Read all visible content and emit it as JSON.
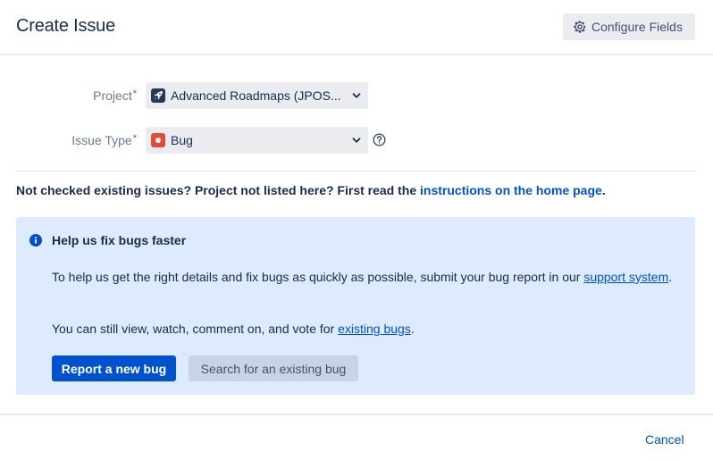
{
  "dialog": {
    "title": "Create Issue",
    "configure_label": "Configure Fields"
  },
  "form": {
    "project": {
      "label": "Project",
      "required_mark": "*",
      "value": "Advanced Roadmaps (JPOS...",
      "icon": "rocket-icon"
    },
    "issue_type": {
      "label": "Issue Type",
      "required_mark": "*",
      "value": "Bug",
      "icon": "bug-icon"
    }
  },
  "notice": {
    "text": "Not checked existing issues? Project not listed here? First read the ",
    "link": "instructions on the home page",
    "suffix": "."
  },
  "panel": {
    "title": "Help us fix bugs faster",
    "p1_text": "To help us get the right details and fix bugs as quickly as possible, submit your bug report in our ",
    "p1_link": "support system",
    "p1_suffix": ".",
    "p2_text": "You can still view, watch, comment on, and vote for ",
    "p2_link": "existing bugs",
    "p2_suffix": ".",
    "primary_button": "Report a new bug",
    "secondary_button": "Search for an existing bug"
  },
  "footer": {
    "cancel_label": "Cancel"
  },
  "colors": {
    "accent": "#0052cc",
    "panel_bg": "#deebff",
    "required": "#de350b",
    "bug": "#e5493a"
  }
}
